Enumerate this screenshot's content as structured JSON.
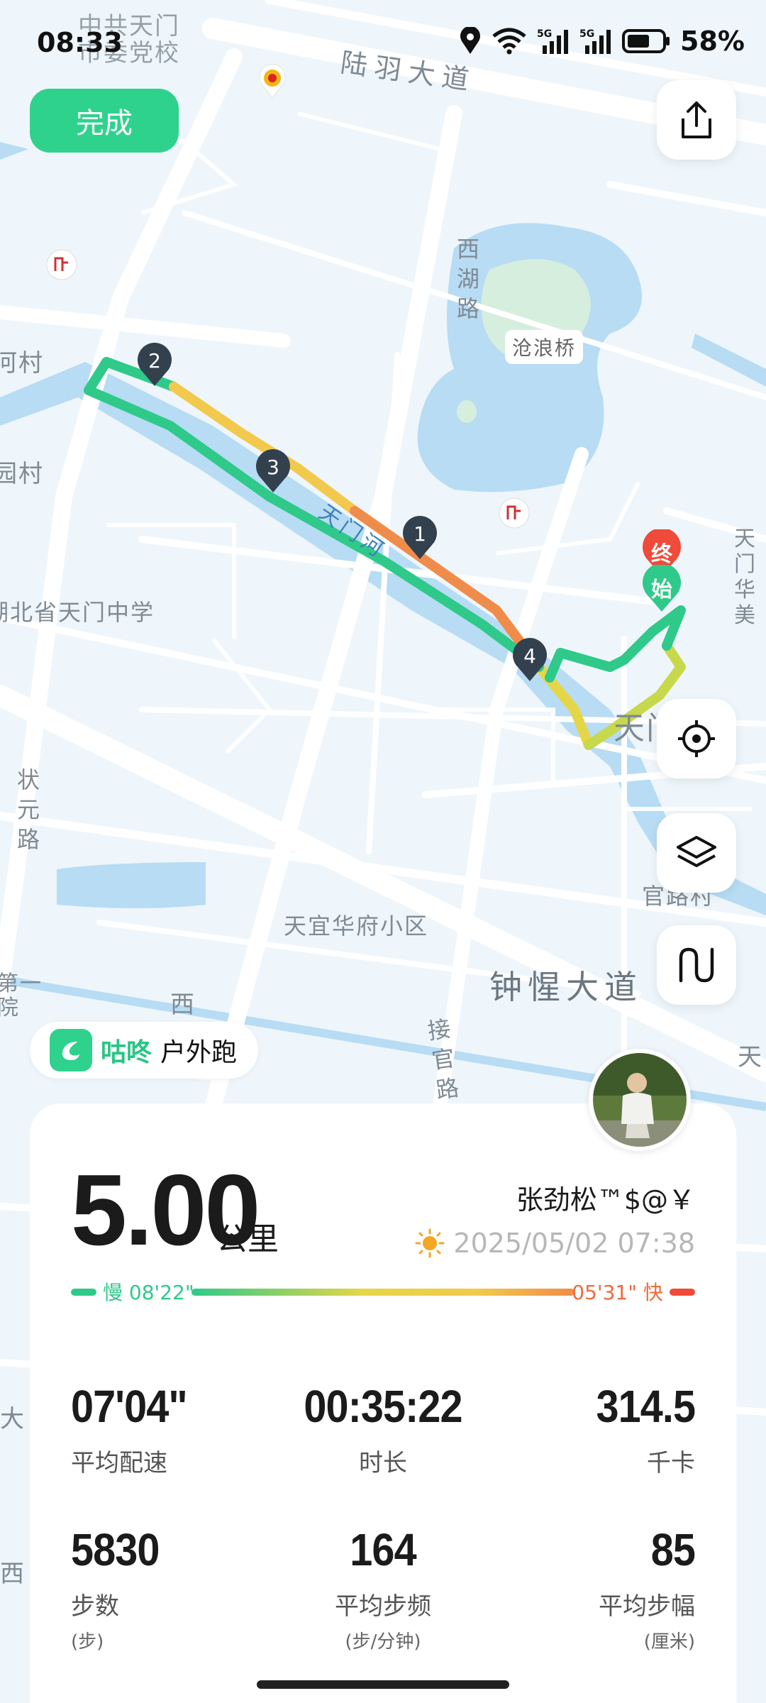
{
  "status_bar": {
    "time": "08:33",
    "battery": "58%"
  },
  "toolbar": {
    "done_label": "完成"
  },
  "map_labels": {
    "school": "中共天门\n市委党校",
    "luyu_road": "陆羽大道",
    "xihu_road": "西湖路",
    "canglang_bridge": "沧浪桥",
    "tianmen_river": "天门河",
    "village1": "河村",
    "village2": "园村",
    "middle_school": "湖北省天门中学",
    "zhuangyuan_road": "状元路",
    "tianyi": "天宜华府小区",
    "zhongxing": "钟惺大道",
    "jieguan": "接官路",
    "guanlu": "官路村",
    "tianmen": "天门",
    "tianhua": "天门华美",
    "xi": "西",
    "diyi": "第一院",
    "tian_right": "天",
    "da_left": "大",
    "xi_left": "西"
  },
  "route_markers": [
    "1",
    "2",
    "3",
    "4"
  ],
  "end_label": "终",
  "start_label": "始",
  "brand": {
    "name": "咕咚",
    "activity": "户外跑"
  },
  "summary": {
    "distance": "5.00",
    "distance_unit": "公里",
    "user_name": "张劲松™$@￥",
    "date_time": "2025/05/02 07:38",
    "slow_label": "慢 08'22\"",
    "fast_label": "05'31\" 快"
  },
  "stats": [
    {
      "value": "07'04\"",
      "label": "平均配速",
      "unit": ""
    },
    {
      "value": "00:35:22",
      "label": "时长",
      "unit": ""
    },
    {
      "value": "314.5",
      "label": "千卡",
      "unit": ""
    },
    {
      "value": "5830",
      "label": "步数",
      "unit": "(步)"
    },
    {
      "value": "164",
      "label": "平均步频",
      "unit": "(步/分钟)"
    },
    {
      "value": "85",
      "label": "平均步幅",
      "unit": "(厘米)"
    }
  ],
  "icons": [
    "location-icon",
    "wifi-icon",
    "signal-5g-icon",
    "battery-icon",
    "share-icon",
    "locate-icon",
    "layers-icon",
    "route-toggle-icon",
    "weather-sun-icon"
  ],
  "colors": {
    "accent": "#2fd28d",
    "slow": "#2fc98a",
    "fast": "#ee6a3a",
    "end_pin": "#f04a3a"
  }
}
